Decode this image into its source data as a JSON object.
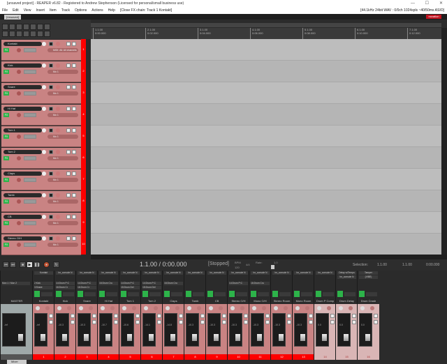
{
  "window": {
    "title": "[unsaved project] - REAPER v6.82 - Registered to Andrew Stephenson (Licensed for personal/small business use)",
    "min": "—",
    "max": "☐",
    "close": "✕"
  },
  "menu": {
    "items": [
      "File",
      "Edit",
      "View",
      "Insert",
      "Item",
      "Track",
      "Options",
      "Actions",
      "Help",
      "[Close FX chain: Track 1 Kontakt]"
    ],
    "status": "[44.1kHz 24bit WAV : 0/0ch 1024spls ~40/50ms ASIO]"
  },
  "tab": "[Unsaved]",
  "logo": "novation",
  "ruler": [
    {
      "bar": "1.1.00",
      "time": "0:00.000"
    },
    {
      "bar": "2.1.00",
      "time": "0:02.000"
    },
    {
      "bar": "3.1.00",
      "time": "0:04.000"
    },
    {
      "bar": "4.1.00",
      "time": "0:06.000"
    },
    {
      "bar": "5.1.00",
      "time": "0:08.000"
    },
    {
      "bar": "6.1.00",
      "time": "0:10.000"
    },
    {
      "bar": "7.1.00",
      "time": "0:12.000"
    }
  ],
  "tracks": [
    {
      "n": "1",
      "name": "Kontakt",
      "route": "MIDI: All: All channels"
    },
    {
      "n": "2",
      "name": "Kick",
      "route": "Mo 1"
    },
    {
      "n": "3",
      "name": "Snare",
      "route": "Mo 1"
    },
    {
      "n": "4",
      "name": "Hi Hat",
      "route": "Mo 1"
    },
    {
      "n": "5",
      "name": "Tom 1",
      "route": "Mo 1"
    },
    {
      "n": "6",
      "name": "Tom 2",
      "route": "Mo 1"
    },
    {
      "n": "7",
      "name": "Claps",
      "route": "Mo 1"
    },
    {
      "n": "8",
      "name": "Tamb",
      "route": "Mo 1"
    },
    {
      "n": "9",
      "name": "CB",
      "route": "Mo 1"
    },
    {
      "n": "10",
      "name": "Stereo O/H",
      "route": "Mo 1"
    }
  ],
  "transport": {
    "position": "1.1.00 / 0:00.000",
    "state": "[Stopped]",
    "bpm_label": "BPM",
    "bpm": "120",
    "timesig": "4/4",
    "rate_label": "Rate:",
    "rate": "1.0",
    "selection_label": "Selection:",
    "sel_start": "1.1.00",
    "sel_end": "1.1.00",
    "sel_len": "0:00.000"
  },
  "mixer": {
    "tab": "Mixer",
    "master": {
      "name": "MASTER",
      "send": "Mon 1 / Mon 2",
      "val": "-inf"
    },
    "strips": [
      {
        "n": "1",
        "name": "Kontakt",
        "fx": [
          "Kontakt"
        ],
        "sends": [
          "2:Kick",
          "3:Snare"
        ],
        "val": "-inf"
      },
      {
        "n": "2",
        "name": "Kick",
        "fx": [
          "bx_console N"
        ],
        "sends": [
          "14:Drum P:C",
          "16:Drum Cr"
        ],
        "val": "-10.3"
      },
      {
        "n": "3",
        "name": "Snare",
        "fx": [
          "bx_console N"
        ],
        "sends": [
          "14:Drum P:C",
          "16:Drum Cr"
        ],
        "val": "-10.3"
      },
      {
        "n": "4",
        "name": "Hi Hat",
        "fx": [
          "bx_console N"
        ],
        "sends": [
          "16:Drum Cru"
        ],
        "val": "-10.7"
      },
      {
        "n": "5",
        "name": "Tom 1",
        "fx": [
          "bx_console N"
        ],
        "sends": [
          "14:Drum P:C",
          "15:Drum Del"
        ],
        "val": "-10.6"
      },
      {
        "n": "6",
        "name": "Tom 2",
        "fx": [
          "bx_console N"
        ],
        "sends": [
          "14:Drum P:C",
          "15:Drum Del"
        ],
        "val": "-14.1"
      },
      {
        "n": "7",
        "name": "Claps",
        "fx": [
          "bx_console N"
        ],
        "sends": [
          "16:Drum Cru"
        ],
        "val": "-14.8"
      },
      {
        "n": "8",
        "name": "Tamb",
        "fx": [
          "bx_console N"
        ],
        "sends": [],
        "val": "-10.3"
      },
      {
        "n": "9",
        "name": "CB",
        "fx": [
          "bx_console N"
        ],
        "sends": [],
        "val": "-10.3"
      },
      {
        "n": "10",
        "name": "Stereo O/H",
        "fx": [
          "bx_console N"
        ],
        "sends": [
          "14:Drum P:C"
        ],
        "val": "-10.3"
      },
      {
        "n": "11",
        "name": "Mono O/H",
        "fx": [
          "bx_console N"
        ],
        "sends": [
          "16:Drum Cru"
        ],
        "val": "-10.3"
      },
      {
        "n": "12",
        "name": "Stereo Room",
        "fx": [
          "bx_console N"
        ],
        "sends": [],
        "val": "-10.3"
      },
      {
        "n": "13",
        "name": "Mono Room",
        "fx": [
          "bx_console N"
        ],
        "sends": [],
        "val": "-10.3"
      },
      {
        "n": "14",
        "name": "Drum P Comp",
        "fx": [
          "bx_console N"
        ],
        "sends": [],
        "val": "0.0"
      },
      {
        "n": "15",
        "name": "Drum Delay",
        "fx": [
          "Delay w/Tempo",
          "bx_console N"
        ],
        "sends": [],
        "val": "0.0"
      },
      {
        "n": "16",
        "name": "Drum Crush",
        "fx": [
          "Tamper",
          "(VIBE)"
        ],
        "sends": [],
        "val": "0.0"
      }
    ]
  },
  "colors": {
    "track": "#c98383",
    "trackNum": "#ff0000",
    "fxOn": "#2db34a",
    "busStrip": "#d9b5b5"
  }
}
